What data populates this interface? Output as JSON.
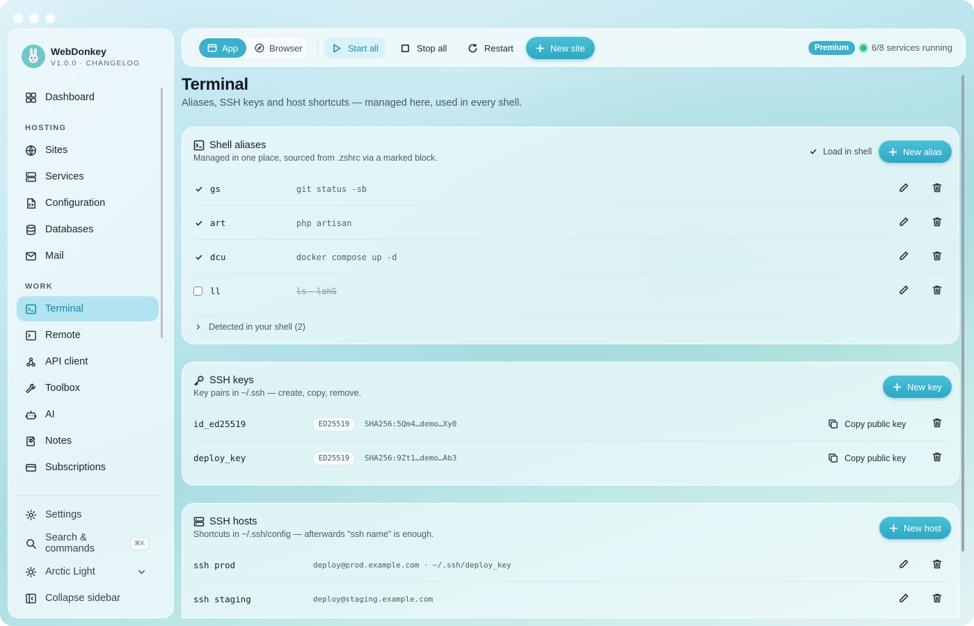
{
  "app": {
    "name": "WebDonkey",
    "version_line": "V1.0.0 · CHANGELOG"
  },
  "sidebar": {
    "top_item": "Dashboard",
    "section_hosting": "HOSTING",
    "hosting": [
      "Sites",
      "Services",
      "Configuration",
      "Databases",
      "Mail"
    ],
    "section_work": "WORK",
    "work": [
      "Terminal",
      "Remote",
      "API client",
      "Toolbox",
      "AI",
      "Notes",
      "Subscriptions"
    ],
    "active_item": "Terminal",
    "settings": "Settings",
    "search": "Search & commands",
    "search_shortcut": "⌘K",
    "theme": "Arctic Light",
    "collapse": "Collapse sidebar"
  },
  "toolbar": {
    "app_tab": "App",
    "browser_tab": "Browser",
    "start_all": "Start all",
    "stop_all": "Stop all",
    "restart": "Restart",
    "new_site": "New site",
    "premium": "Premium",
    "status": "6/8 services running",
    "status_color": "#2fbf8f"
  },
  "page": {
    "title": "Terminal",
    "subtitle": "Aliases, SSH keys and host shortcuts — managed here, used in every shell."
  },
  "aliases": {
    "title": "Shell aliases",
    "desc": "Managed in one place, sourced from .zshrc via a marked block.",
    "load_in_shell": "Load in shell",
    "new_button": "New alias",
    "rows": [
      {
        "name": "gs",
        "command": "git status -sb",
        "enabled": true
      },
      {
        "name": "art",
        "command": "php artisan",
        "enabled": true
      },
      {
        "name": "dcu",
        "command": "docker compose up -d",
        "enabled": true
      },
      {
        "name": "ll",
        "command": "ls -lahG",
        "enabled": false
      }
    ],
    "detected": "Detected in your shell (2)"
  },
  "ssh_keys": {
    "title": "SSH keys",
    "desc": "Key pairs in ~/.ssh — create, copy, remove.",
    "new_button": "New key",
    "copy_label": "Copy public key",
    "rows": [
      {
        "name": "id_ed25519",
        "type": "ED25519",
        "fingerprint": "SHA256:5Qm4…demo…Xy0"
      },
      {
        "name": "deploy_key",
        "type": "ED25519",
        "fingerprint": "SHA256:9Zt1…demo…Ab3"
      }
    ]
  },
  "ssh_hosts": {
    "title": "SSH hosts",
    "desc": "Shortcuts in ~/.ssh/config — afterwards \"ssh name\" is enough.",
    "new_button": "New host",
    "rows": [
      {
        "name": "ssh prod",
        "target": "deploy@prod.example.com · ~/.ssh/deploy_key"
      },
      {
        "name": "ssh staging",
        "target": "deploy@staging.example.com"
      }
    ]
  },
  "colors": {
    "accent": "#3bb0cb",
    "active_text": "#0f8aa5"
  }
}
